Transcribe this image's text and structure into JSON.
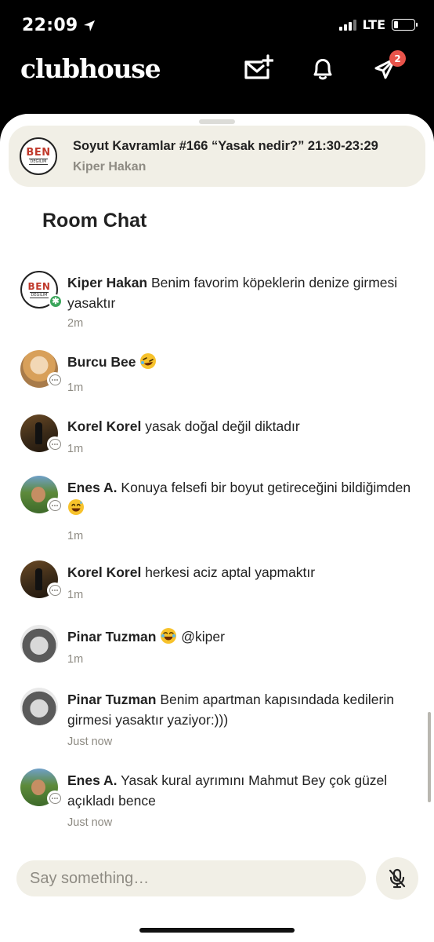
{
  "status_bar": {
    "time": "22:09",
    "network": "LTE",
    "battery_level": 0.2
  },
  "header": {
    "logo": "clubhouse",
    "notifications_badge": "2"
  },
  "room": {
    "title": "Soyut Kavramlar #166 “Yasak nedir?” 21:30-23:29",
    "host": "Kiper Hakan",
    "avatar_text": "BEN",
    "avatar_subtext": "DEĞİLİM"
  },
  "chat": {
    "title": "Room Chat",
    "messages": [
      {
        "name": "Kiper Hakan",
        "text": "Benim favorim köpeklerin denize girmesi yasaktır",
        "time": "2m"
      },
      {
        "name": "Burcu Bee",
        "text": "",
        "emoji": "rofl",
        "time": "1m"
      },
      {
        "name": "Korel Korel",
        "text": "yasak doğal değil diktadır",
        "time": "1m"
      },
      {
        "name": "Enes A.",
        "text": "Konuya felsefi bir boyut getireceğini bildiğimden",
        "emoji": "sweat-smile",
        "time": "1m"
      },
      {
        "name": "Korel Korel",
        "text": "herkesi aciz aptal yapmaktır",
        "time": "1m"
      },
      {
        "name": "Pinar Tuzman",
        "text": "@kiper",
        "emoji": "joy",
        "time": "1m"
      },
      {
        "name": "Pinar Tuzman",
        "text": "Benim apartman kapısındada kedilerin girmesi yasaktır yaziyor:)))",
        "time": "Just now"
      },
      {
        "name": "Enes A.",
        "text": "Yasak kural ayrımını Mahmut Bey çok güzel açıkladı bence",
        "time": "Just now"
      }
    ]
  },
  "composer": {
    "placeholder": "Say something…"
  },
  "icons": {
    "compose_message": "mail-plus-icon",
    "notifications": "bell-icon",
    "activity": "paper-plane-icon",
    "mic": "mic-muted-icon",
    "location": "location-arrow-icon"
  }
}
